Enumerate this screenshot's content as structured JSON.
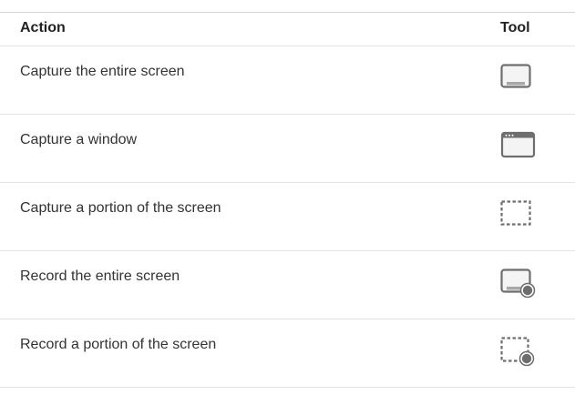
{
  "table": {
    "headers": {
      "action": "Action",
      "tool": "Tool"
    },
    "rows": [
      {
        "action": "Capture the entire screen",
        "icon": "capture-entire-screen-icon"
      },
      {
        "action": "Capture a window",
        "icon": "capture-window-icon"
      },
      {
        "action": "Capture a portion of the screen",
        "icon": "capture-portion-icon"
      },
      {
        "action": "Record the entire screen",
        "icon": "record-entire-screen-icon"
      },
      {
        "action": "Record a portion of the screen",
        "icon": "record-portion-icon"
      }
    ]
  },
  "colors": {
    "text": "#333333",
    "header_text": "#222222",
    "rule": "#e3e3e3",
    "icon_gray": "#6e6e6e",
    "icon_fill": "#a8a8a8"
  }
}
